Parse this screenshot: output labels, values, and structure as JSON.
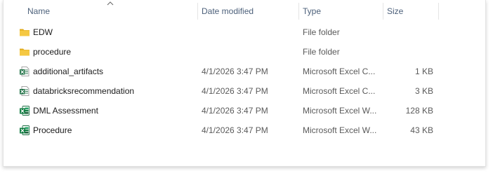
{
  "columns": {
    "name": "Name",
    "date_modified": "Date modified",
    "type": "Type",
    "size": "Size"
  },
  "colors": {
    "folder": "#f5c842",
    "folder_dark": "#e1aa1a",
    "excel_green": "#1d7044",
    "header_text": "#4c607a"
  },
  "files": [
    {
      "name": "EDW",
      "date": "",
      "type": "File folder",
      "size": "",
      "icon": "folder-icon"
    },
    {
      "name": "procedure",
      "date": "",
      "type": "File folder",
      "size": "",
      "icon": "folder-icon"
    },
    {
      "name": "additional_artifacts",
      "date": "4/1/2026 3:47 PM",
      "type": "Microsoft Excel C...",
      "size": "1 KB",
      "icon": "excel-csv-icon"
    },
    {
      "name": "databricksrecommendation",
      "date": "4/1/2026 3:47 PM",
      "type": "Microsoft Excel C...",
      "size": "3 KB",
      "icon": "excel-csv-icon"
    },
    {
      "name": "DML Assessment",
      "date": "4/1/2026 3:47 PM",
      "type": "Microsoft Excel W...",
      "size": "128 KB",
      "icon": "excel-workbook-icon"
    },
    {
      "name": "Procedure",
      "date": "4/1/2026 3:47 PM",
      "type": "Microsoft Excel W...",
      "size": "43 KB",
      "icon": "excel-workbook-icon"
    }
  ]
}
